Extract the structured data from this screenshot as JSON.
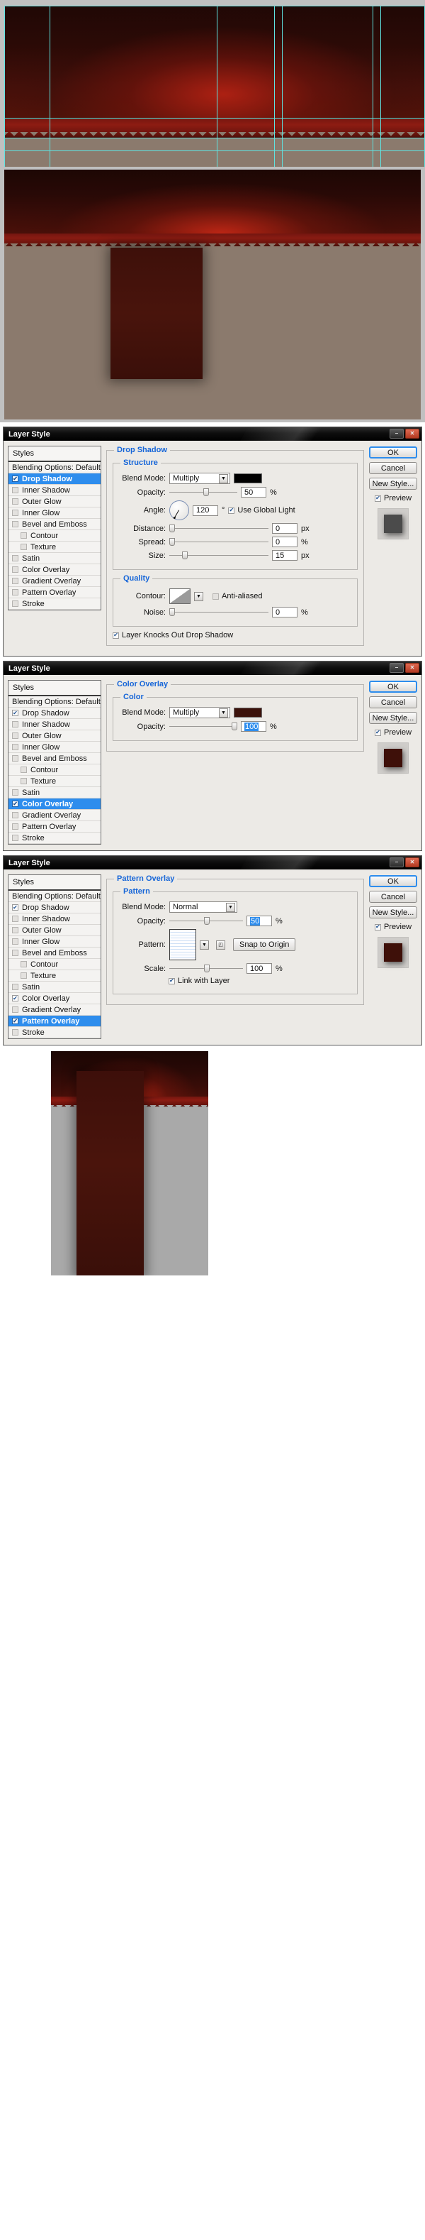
{
  "dialog": {
    "title": "Layer Style",
    "window_buttons": {
      "minimize": "–",
      "close": "✕"
    },
    "styles_header": "Styles",
    "blending_options": "Blending Options: Default",
    "style_items": [
      "Drop Shadow",
      "Inner Shadow",
      "Outer Glow",
      "Inner Glow",
      "Bevel and Emboss",
      "Contour",
      "Texture",
      "Satin",
      "Color Overlay",
      "Gradient Overlay",
      "Pattern Overlay",
      "Stroke"
    ],
    "buttons": {
      "ok": "OK",
      "cancel": "Cancel",
      "new_style": "New Style...",
      "preview": "Preview"
    }
  },
  "drop_shadow": {
    "section_title": "Drop Shadow",
    "structure_title": "Structure",
    "blend_mode_label": "Blend Mode:",
    "blend_mode_value": "Multiply",
    "shadow_color": "#000000",
    "opacity_label": "Opacity:",
    "opacity_value": "50",
    "opacity_unit": "%",
    "angle_label": "Angle:",
    "angle_value": "120",
    "angle_unit": "°",
    "use_global_light": "Use Global Light",
    "distance_label": "Distance:",
    "distance_value": "0",
    "distance_unit": "px",
    "spread_label": "Spread:",
    "spread_value": "0",
    "spread_unit": "%",
    "size_label": "Size:",
    "size_value": "15",
    "size_unit": "px",
    "quality_title": "Quality",
    "contour_label": "Contour:",
    "anti_aliased": "Anti-aliased",
    "noise_label": "Noise:",
    "noise_value": "0",
    "noise_unit": "%",
    "knockout": "Layer Knocks Out Drop Shadow"
  },
  "color_overlay": {
    "section_title": "Color Overlay",
    "color_title": "Color",
    "blend_mode_label": "Blend Mode:",
    "blend_mode_value": "Multiply",
    "overlay_color": "#3c120b",
    "opacity_label": "Opacity:",
    "opacity_value": "100",
    "opacity_unit": "%"
  },
  "pattern_overlay": {
    "section_title": "Pattern Overlay",
    "pattern_title": "Pattern",
    "blend_mode_label": "Blend Mode:",
    "blend_mode_value": "Normal",
    "opacity_label": "Opacity:",
    "opacity_value": "50",
    "opacity_unit": "%",
    "pattern_label": "Pattern:",
    "snap_to_origin": "Snap to Origin",
    "scale_label": "Scale:",
    "scale_value": "100",
    "scale_unit": "%",
    "link_with_layer": "Link with Layer"
  },
  "canvas": {
    "guide_color": "#5fe3e0",
    "wall_color": "#3d0d08",
    "baseboard_color": "#8d1c12",
    "floor_color": "#8b7a6d",
    "curtain_color": "#49140c",
    "final_bg_color": "#a9a9a9"
  }
}
